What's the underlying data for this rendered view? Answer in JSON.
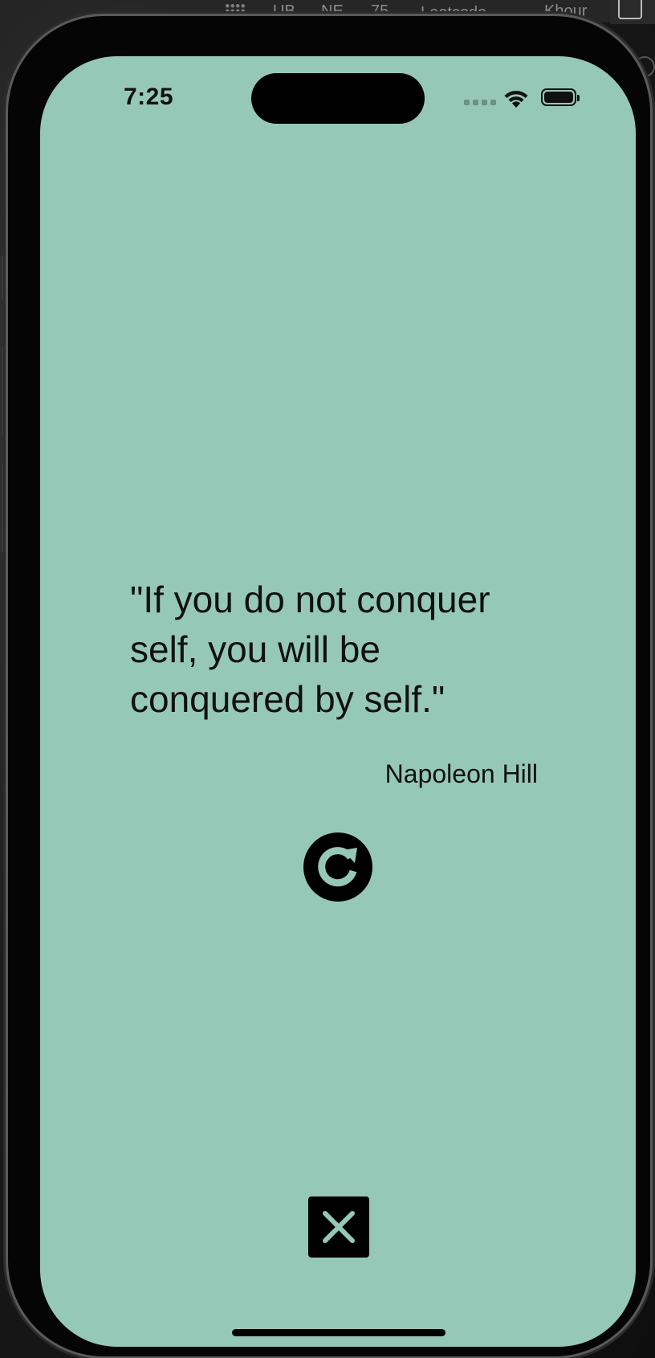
{
  "host_toolbar": {
    "bookmarks": [
      "UB",
      "NE",
      "75",
      "Leetcode",
      "Khour"
    ]
  },
  "status_bar": {
    "time": "7:25"
  },
  "quote": {
    "text": "\"If you do not conquer self, you will be conquered by self.\"",
    "author": "Napoleon Hill"
  },
  "colors": {
    "screen_background": "#96c8b8",
    "foreground": "#000000"
  },
  "icons": {
    "refresh": "refresh-icon",
    "close": "close-icon"
  }
}
